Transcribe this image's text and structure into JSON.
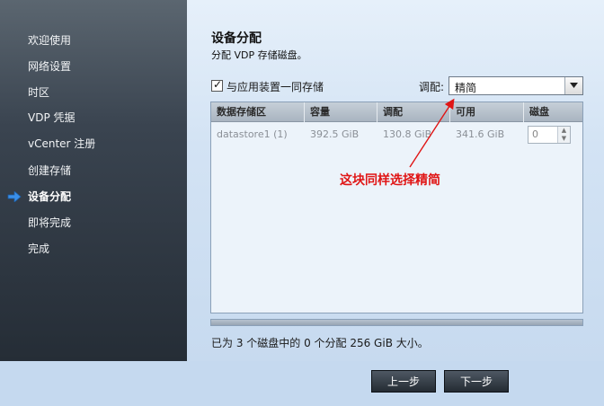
{
  "sidebar": {
    "items": [
      {
        "label": "欢迎使用"
      },
      {
        "label": "网络设置"
      },
      {
        "label": "时区"
      },
      {
        "label": "VDP 凭据"
      },
      {
        "label": "vCenter 注册"
      },
      {
        "label": "创建存储"
      },
      {
        "label": "设备分配",
        "active": true
      },
      {
        "label": "即将完成"
      },
      {
        "label": "完成"
      }
    ],
    "active_icon": "arrow-right-icon"
  },
  "main": {
    "title": "设备分配",
    "subtitle": "分配 VDP 存储磁盘。",
    "colocate_checkbox": {
      "label": "与应用装置一同存储",
      "checked": true
    },
    "provisioning": {
      "label": "调配:",
      "value": "精简"
    },
    "table": {
      "columns": [
        "数据存储区",
        "容量",
        "调配",
        "可用",
        "磁盘"
      ],
      "rows": [
        {
          "datastore": "datastore1 (1)",
          "capacity": "392.5 GiB",
          "provisioned": "130.8 GiB",
          "available": "341.6 GiB",
          "disks": "0"
        }
      ]
    },
    "annotation": "这块同样选择精简",
    "summary": "已为 3 个磁盘中的 0 个分配 256 GiB 大小。"
  },
  "footer": {
    "back_label": "上一步",
    "next_label": "下一步"
  },
  "colors": {
    "annotation": "#e01515",
    "active_arrow": "#3a8fe8"
  }
}
